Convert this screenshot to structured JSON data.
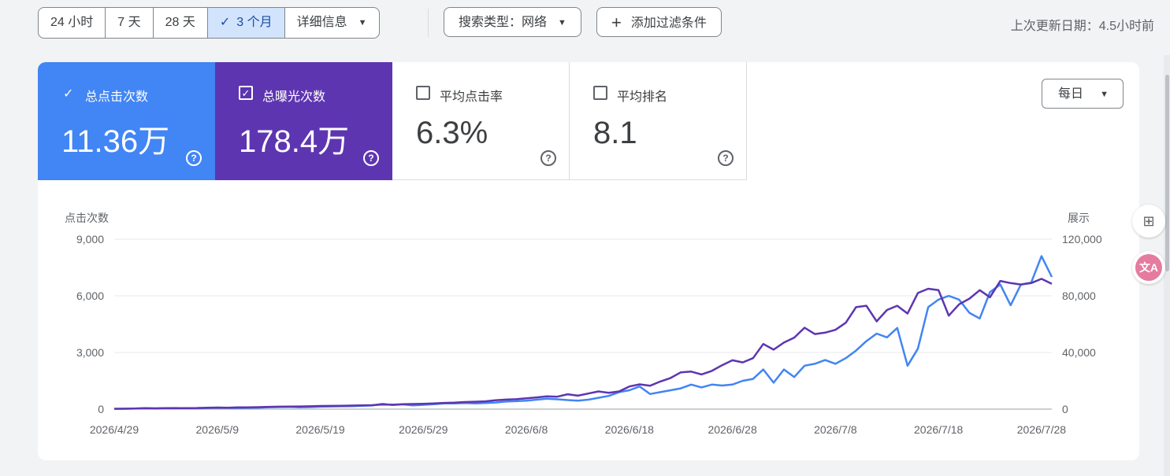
{
  "toolbar": {
    "range_options": [
      "24 小时",
      "7 天",
      "28 天",
      "3 个月",
      "详细信息"
    ],
    "selected_range": "3 个月",
    "search_type": "搜索类型：网络",
    "add_filter": "添加过滤条件",
    "last_updated": "上次更新日期：4.5小时前"
  },
  "metrics": [
    {
      "label": "总点击次数",
      "value": "11.36万",
      "checked": true,
      "color": "#4285f4"
    },
    {
      "label": "总曝光次数",
      "value": "178.4万",
      "checked": true,
      "color": "#5e35b1"
    },
    {
      "label": "平均点击率",
      "value": "6.3%",
      "checked": false
    },
    {
      "label": "平均排名",
      "value": "8.1",
      "checked": false
    }
  ],
  "granularity": "每日",
  "chart_data": {
    "type": "line",
    "xlabel": "",
    "left_axis_label": "点击次数",
    "right_axis_label": "展示",
    "left_ylim": [
      0,
      9000
    ],
    "right_ylim": [
      0,
      120000
    ],
    "left_ticks": [
      "0",
      "3,000",
      "6,000",
      "9,000"
    ],
    "right_ticks": [
      "0",
      "40,000",
      "80,000",
      "120,000"
    ],
    "x_tick_labels": [
      "2026/4/29",
      "2026/5/9",
      "2026/5/19",
      "2026/5/29",
      "2026/6/8",
      "2026/6/18",
      "2026/6/28",
      "2026/7/8",
      "2026/7/18",
      "2026/7/28"
    ],
    "x_tick_days": [
      0,
      10,
      20,
      30,
      40,
      50,
      60,
      70,
      80,
      90
    ],
    "days": 92,
    "grid": true,
    "series": [
      {
        "name": "总点击次数",
        "axis": "left",
        "color": "#4285f4",
        "values": [
          20,
          20,
          30,
          40,
          50,
          40,
          50,
          60,
          40,
          40,
          50,
          60,
          80,
          70,
          60,
          70,
          80,
          90,
          100,
          110,
          120,
          100,
          110,
          120,
          130,
          140,
          150,
          160,
          180,
          190,
          200,
          280,
          220,
          250,
          200,
          230,
          260,
          280,
          300,
          300,
          320,
          300,
          320,
          340,
          350,
          400,
          420,
          450,
          500,
          550,
          600,
          520,
          480,
          450,
          500,
          600,
          700,
          600,
          900,
          1000,
          1200,
          800,
          900,
          1000,
          850,
          1100,
          1300,
          1150,
          1300,
          1250,
          1100,
          1300,
          1500,
          1600,
          2100,
          1400,
          2100,
          1500,
          1700,
          2300,
          2400,
          2600,
          2400,
          2700,
          2900,
          3100,
          3600,
          4000,
          3800,
          4300,
          3500,
          2300,
          3200,
          5400,
          5800,
          6000,
          5800,
          5200,
          5100,
          4800,
          6200,
          6600,
          5500,
          6600,
          7400,
          6700,
          8100,
          7000
        ],
        "note_ignore": ""
      }
    ]
  }
}
